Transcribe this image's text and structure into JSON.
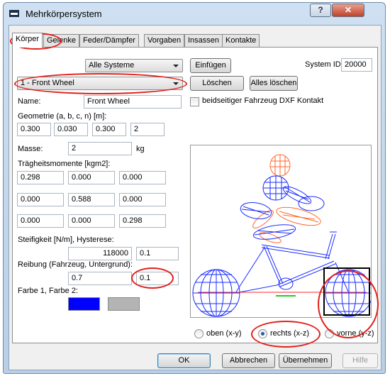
{
  "window": {
    "title": "Mehrkörpersystem",
    "help_glyph": "?",
    "close_glyph": "✕"
  },
  "tabs": [
    "Körper",
    "Gelenke",
    "Feder/Dämpfer",
    "Vorgaben",
    "Insassen",
    "Kontakte"
  ],
  "systems": {
    "selected": "Alle Systeme",
    "insert_label": "Einfügen",
    "system_id_label": "System ID:",
    "system_id_value": "20000"
  },
  "body": {
    "selected": "1 - Front Wheel",
    "delete_label": "Löschen",
    "delete_all_label": "Alles löschen",
    "dxf_contact_label": "beidseitiger Fahrzeug DXF Kontakt",
    "name_label": "Name:",
    "name_value": "Front Wheel",
    "geometry_label": "Geometrie (a, b, c, n) [m]:",
    "geometry_values": [
      "0.300",
      "0.030",
      "0.300",
      "2"
    ],
    "mass_label": "Masse:",
    "mass_value": "2",
    "mass_unit": "kg",
    "inertia_label": "Trägheitsmomente [kgm2]:",
    "inertia_rows": [
      [
        "0.298",
        "0.000",
        "0.000"
      ],
      [
        "0.000",
        "0.588",
        "0.000"
      ],
      [
        "0.000",
        "0.000",
        "0.298"
      ]
    ],
    "stiffness_label": "Steifigkeit [N/m], Hysterese:",
    "stiffness_value": "118000",
    "hysteresis_value": "0.1",
    "friction_label": "Reibung (Fahrzeug, Untergrund):",
    "friction_vehicle": "0.7",
    "friction_ground": "0.1",
    "color_label": "Farbe 1, Farbe 2:",
    "color1": "#0000ff",
    "color2": "#b4b4b4"
  },
  "views": {
    "top": "oben (x-y)",
    "right": "rechts (x-z)",
    "front": "vorne (y-z)",
    "selected": "right"
  },
  "footer": {
    "ok": "OK",
    "cancel": "Abbrechen",
    "apply": "Übernehmen",
    "help": "Hilfe"
  },
  "colors": {
    "highlight": "#e0211b",
    "wire_blue": "#1a2cff",
    "wire_orange": "#ff6a2a"
  }
}
